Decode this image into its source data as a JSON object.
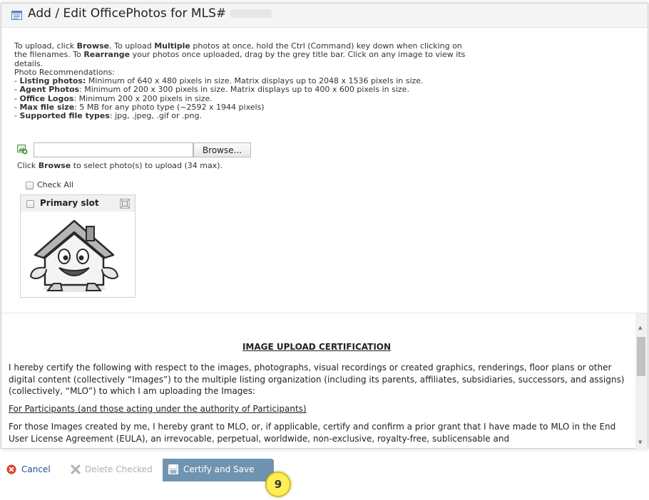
{
  "dialog": {
    "title": "Add / Edit OfficePhotos for MLS#"
  },
  "instructions": {
    "line1_a": "To upload, click ",
    "line1_b": "Browse",
    "line1_c": ". To upload ",
    "line1_d": "Multiple",
    "line1_e": " photos at once, hold the Ctrl (Command) key down when clicking on the filenames. To ",
    "line1_f": "Rearrange",
    "line1_g": " your photos once uploaded, drag by the grey title bar. Click on any image to view its details.",
    "rec_heading": "Photo Recommendations:",
    "recommendations": [
      {
        "label": "Listing photos:",
        "text": " Minimum of 640 x 480 pixels in size. Matrix displays up to 2048 x 1536 pixels in size."
      },
      {
        "label": "Agent Photos",
        "text": ": Minimum of 200 x 300 pixels in size. Matrix displays up to 400 x 600 pixels in size."
      },
      {
        "label": "Office Logos",
        "text": ": Minimum 200 x 200 pixels in size."
      },
      {
        "label": "Max file size",
        "text": ": 5 MB for any photo type (~2592 x 1944 pixels)"
      },
      {
        "label": "Supported file types",
        "text": ": jpg, .jpeg, .gif or .png."
      }
    ]
  },
  "upload": {
    "browse_label": "Browse...",
    "hint_a": "Click ",
    "hint_b": "Browse",
    "hint_c": " to select photo(s) to upload (34 max)."
  },
  "gallery": {
    "check_all_label": "Check All",
    "card_title": "Primary slot"
  },
  "certification": {
    "title": "IMAGE UPLOAD CERTIFICATION",
    "para1": "I hereby certify the following with respect to the images, photographs, visual recordings or created graphics, renderings, floor plans or other digital content (collectively “Images”) to the multiple listing organization (including its parents, affiliates, subsidiaries, successors, and assigns) (collectively, “MLO”) to which I am uploading the Images:",
    "section_link": "For Participants (and those acting under the authority of Participants)",
    "para2": "For those Images created by me, I hereby grant to MLO, or, if applicable, certify and confirm a prior grant that I have made to MLO in the End User License Agreement (EULA), an irrevocable, perpetual, worldwide, non-exclusive, royalty-free, sublicensable and"
  },
  "footer": {
    "cancel_label": "Cancel",
    "delete_label": "Delete Checked",
    "certify_label": "Certify and Save",
    "step_number": "9"
  },
  "colors": {
    "certify_bg": "#6f94b2",
    "step_badge": "#ffee55",
    "cancel_icon": "#d9452f"
  }
}
